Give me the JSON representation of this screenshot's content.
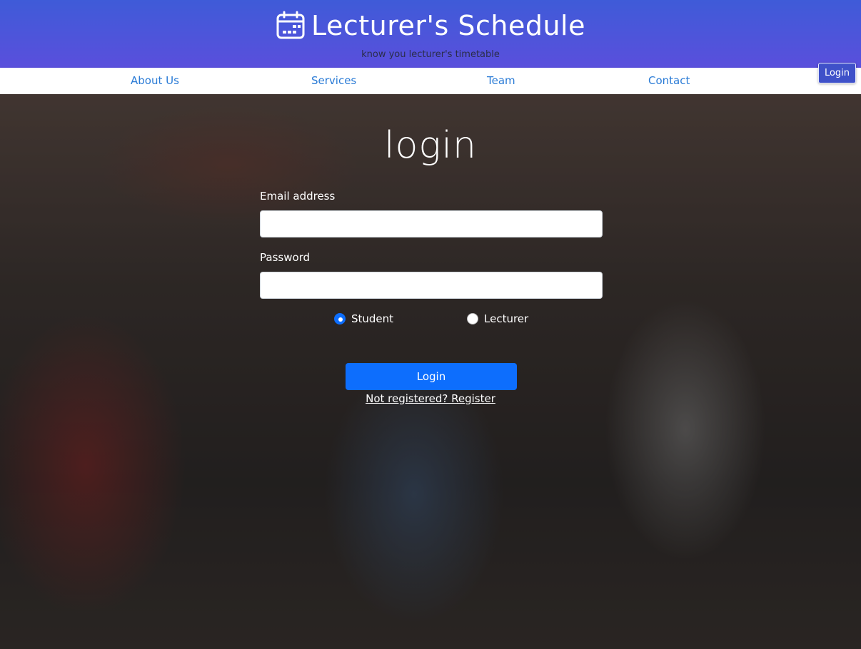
{
  "header": {
    "title": "Lecturer's Schedule",
    "tagline": "know you lecturer's timetable",
    "icon": "calendar-icon"
  },
  "nav": {
    "items": [
      {
        "label": "About Us"
      },
      {
        "label": "Services"
      },
      {
        "label": "Team"
      },
      {
        "label": "Contact"
      }
    ],
    "login_label": "Login"
  },
  "form": {
    "title": "login",
    "email_label": "Email address",
    "email_value": "",
    "password_label": "Password",
    "password_value": "",
    "roles": [
      {
        "label": "Student",
        "checked": true
      },
      {
        "label": "Lecturer",
        "checked": false
      }
    ],
    "submit_label": "Login",
    "register_link": "Not registered? Register"
  },
  "colors": {
    "header_gradient_start": "#3f5bd8",
    "header_gradient_end": "#5a4fdc",
    "nav_link": "#2a7bd6",
    "primary_button": "#0d6efd"
  }
}
